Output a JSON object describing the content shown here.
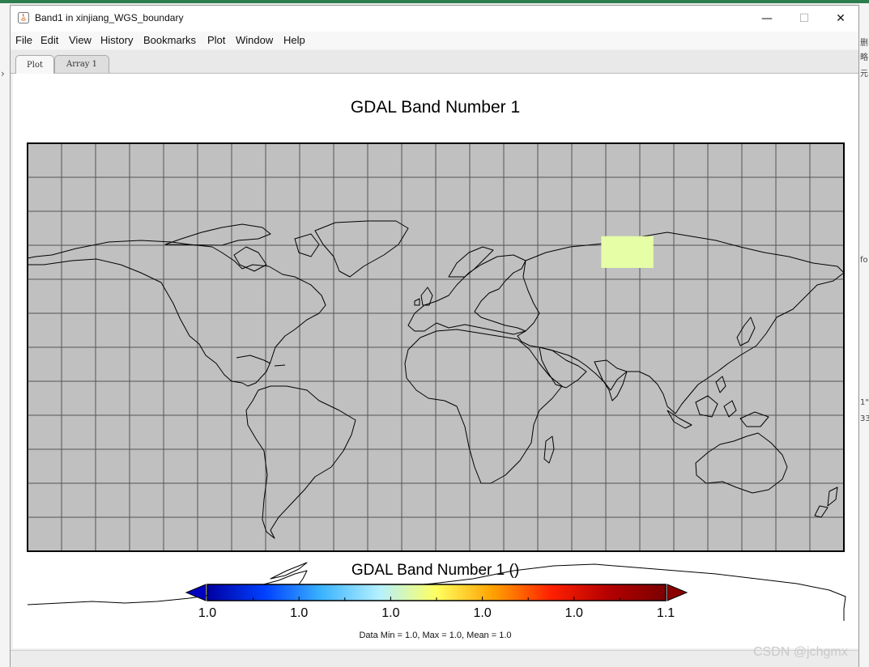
{
  "window": {
    "title": "Band1 in xinjiang_WGS_boundary",
    "minimize_glyph": "—",
    "maximize_glyph": "☐",
    "close_glyph": "✕"
  },
  "menu": [
    "File",
    "Edit",
    "View",
    "History",
    "Bookmarks",
    "Plot",
    "Window",
    "Help"
  ],
  "tabs": [
    {
      "label": "Plot",
      "active": true
    },
    {
      "label": "Array 1",
      "active": false
    }
  ],
  "plot": {
    "title": "GDAL Band Number 1",
    "background_color": "#c0c0c0",
    "grid": true,
    "grid_color": "#555555",
    "data_patch_color": "#e6fea6",
    "data_patch_region": "Xinjiang",
    "colorbar": {
      "title": "GDAL Band Number 1 ()",
      "tick_labels": [
        "1.0",
        "1.0",
        "1.0",
        "1.0",
        "1.0",
        "1.1"
      ],
      "colors": [
        "#0000a0",
        "#0040ff",
        "#3cb4ff",
        "#b4f0ff",
        "#ffff60",
        "#ffa000",
        "#ff2000",
        "#b40000",
        "#7a0000"
      ],
      "under_color": "#0000c0",
      "over_color": "#8b0000"
    },
    "stats": "Data Min = 1.0, Max = 1.0, Mean = 1.0"
  },
  "chart_data": {
    "type": "heatmap",
    "title": "GDAL Band Number 1",
    "xlim": [
      -180,
      180
    ],
    "ylim": [
      -90,
      90
    ],
    "grid": true,
    "patch": {
      "lon_min": 73,
      "lon_max": 96,
      "lat_min": 35,
      "lat_max": 49,
      "value": 1.0
    },
    "colorbar_label": "GDAL Band Number 1 ()",
    "colorbar_ticks": [
      "1.0",
      "1.0",
      "1.0",
      "1.0",
      "1.0",
      "1.1"
    ],
    "data_min": 1.0,
    "data_max": 1.0,
    "data_mean": 1.0
  },
  "background": {
    "fragments": [
      "删",
      "略",
      "元",
      "fo",
      "1\"",
      "33"
    ],
    "watermark": "CSDN @jchgmx"
  }
}
